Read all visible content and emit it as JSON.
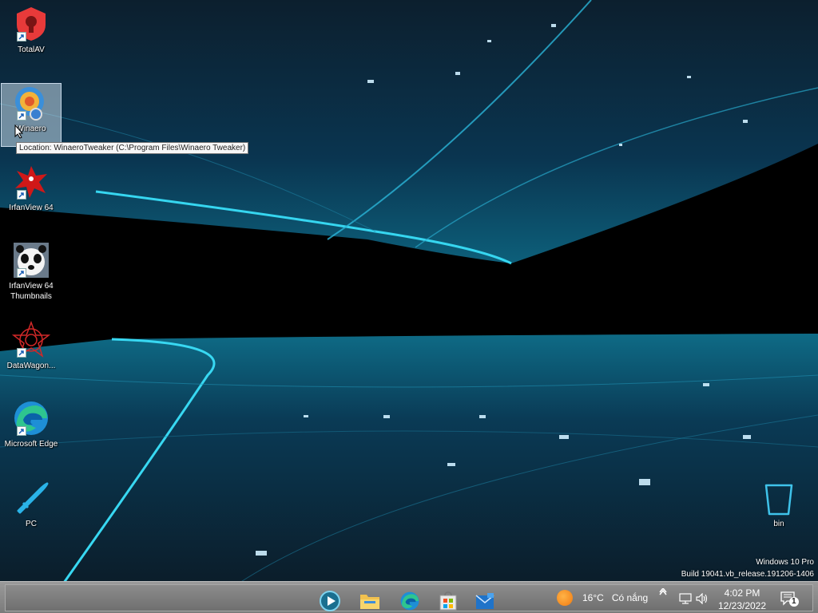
{
  "desktop_icons": [
    {
      "label": "TotalAV",
      "icon": "totalav-icon"
    },
    {
      "label": "Winaero",
      "icon": "winaero-tweaker-icon"
    },
    {
      "label": "IrfanView 64",
      "icon": "irfanview-icon"
    },
    {
      "label": "IrfanView 64\nThumbnails",
      "icon": "irfanview-thumbnails-icon"
    },
    {
      "label": "DataWagon...",
      "icon": "datawagon-icon"
    },
    {
      "label": "Microsoft Edge",
      "icon": "edge-icon"
    },
    {
      "label": "PC",
      "icon": "pc-icon"
    },
    {
      "label": "bin",
      "icon": "recycle-bin-icon"
    }
  ],
  "tooltip": "Location: WinaeroTweaker (C:\\Program Files\\Winaero Tweaker)",
  "watermark": {
    "line1": "Windows 10 Pro",
    "line2": "Build 19041.vb_release.191206-1406"
  },
  "taskbar": {
    "apps": [
      {
        "icon": "media-player-icon"
      },
      {
        "icon": "file-explorer-icon"
      },
      {
        "icon": "edge-icon"
      },
      {
        "icon": "store-icon"
      },
      {
        "icon": "mail-icon"
      }
    ],
    "weather": {
      "temp": "16°C",
      "desc": "Có nắng"
    },
    "clock": {
      "time": "4:02 PM",
      "date": "12/23/2022"
    },
    "notifications_badge": "1"
  },
  "colors": {
    "accent_cyan": "#29c6e8",
    "taskbar": "#808080"
  }
}
